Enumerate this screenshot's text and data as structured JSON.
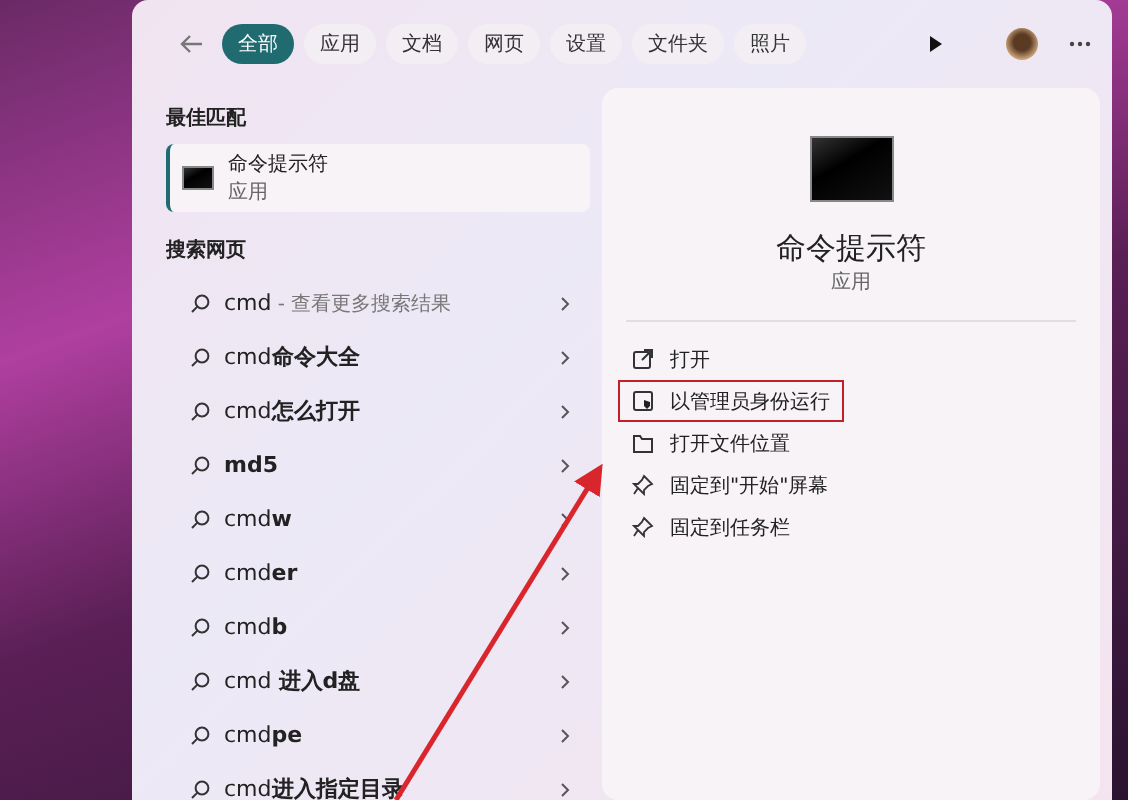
{
  "tabs": [
    {
      "label": "全部",
      "selected": true
    },
    {
      "label": "应用",
      "selected": false
    },
    {
      "label": "文档",
      "selected": false
    },
    {
      "label": "网页",
      "selected": false
    },
    {
      "label": "设置",
      "selected": false
    },
    {
      "label": "文件夹",
      "selected": false
    },
    {
      "label": "照片",
      "selected": false
    }
  ],
  "best_match": {
    "heading": "最佳匹配",
    "name": "命令提示符",
    "type": "应用"
  },
  "web_search": {
    "heading": "搜索网页",
    "items": [
      {
        "text": "cmd",
        "hint": " - 查看更多搜索结果"
      },
      {
        "text": "cmd**命令大全**"
      },
      {
        "text": "cmd**怎么打开**"
      },
      {
        "text": "**md5**"
      },
      {
        "text": "cmd**w**"
      },
      {
        "text": "cmd**er**"
      },
      {
        "text": "cmd**b**"
      },
      {
        "text": "cmd **进入d盘**"
      },
      {
        "text": "cmd**pe**"
      },
      {
        "text": "cmd**进入指定目录**"
      }
    ]
  },
  "detail": {
    "name": "命令提示符",
    "type": "应用",
    "actions": [
      {
        "kind": "open",
        "label": "打开",
        "highlighted": false
      },
      {
        "kind": "admin",
        "label": "以管理员身份运行",
        "highlighted": true
      },
      {
        "kind": "folder",
        "label": "打开文件位置",
        "highlighted": false
      },
      {
        "kind": "pin",
        "label": "固定到\"开始\"屏幕",
        "highlighted": false
      },
      {
        "kind": "pin",
        "label": "固定到任务栏",
        "highlighted": false
      }
    ]
  }
}
